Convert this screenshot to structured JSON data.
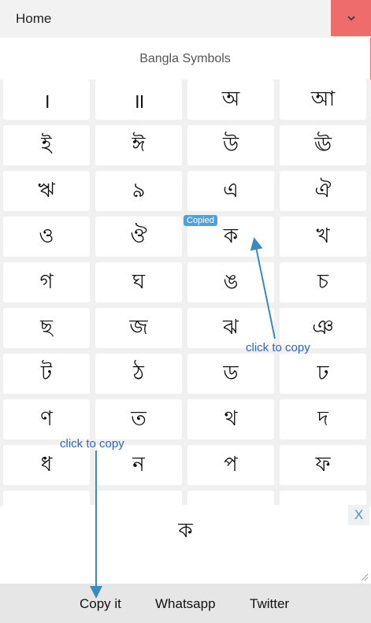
{
  "header": {
    "home_label": "Home",
    "menu_icon": "chevron-down-icon",
    "accent_color": "#ef6c6c"
  },
  "title": "Bangla Symbols",
  "symbols": [
    "।",
    "॥",
    "অ",
    "আ",
    "ই",
    "ঈ",
    "উ",
    "ঊ",
    "ঋ",
    "৯",
    "এ",
    "ঐ",
    "ও",
    "ঔ",
    "ক",
    "খ",
    "গ",
    "ঘ",
    "ঙ",
    "চ",
    "ছ",
    "জ",
    "ঝ",
    "ঞ",
    "ট",
    "ঠ",
    "ড",
    "ঢ",
    "ণ",
    "ত",
    "থ",
    "দ",
    "ধ",
    "ন",
    "প",
    "ফ"
  ],
  "copied_badge": "Copied",
  "output": {
    "value": "ক",
    "clear_label": "X"
  },
  "actions": {
    "copy_label": "Copy it",
    "whatsapp_label": "Whatsapp",
    "twitter_label": "Twitter"
  },
  "annotations": {
    "grid_hint": "click to copy",
    "copy_hint": "click to copy",
    "color": "#2a64c8"
  }
}
